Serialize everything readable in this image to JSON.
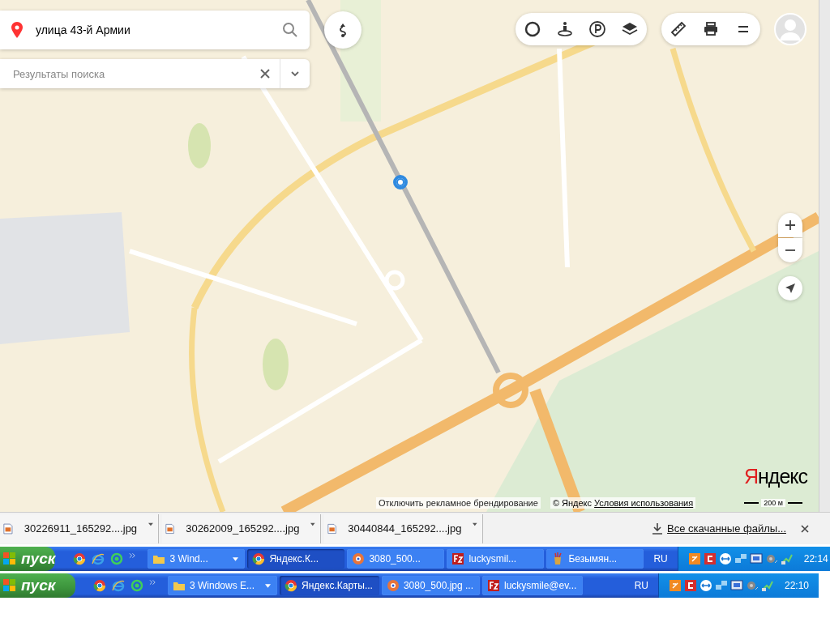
{
  "search": {
    "value": "улица 43-й Армии"
  },
  "results": {
    "placeholder": "Результаты поиска"
  },
  "map_footer": {
    "logo": "Яндекс",
    "disable_branding": "Отключить рекламное брендирование",
    "copyright": "© Яндекс",
    "terms_link": "Условия использования",
    "scale": "200 м"
  },
  "downloads": {
    "items": [
      "30226911_165292....jpg",
      "30262009_165292....jpg",
      "30440844_165292....jpg"
    ],
    "show_all": "Все скачанные файлы..."
  },
  "taskbars": [
    {
      "start": "пуск",
      "tasks": [
        {
          "kind": "folder",
          "label": "3 Wind...",
          "selected": false,
          "group": true
        },
        {
          "kind": "chrome",
          "label": "Яндекс.К...",
          "selected": true,
          "group": false
        },
        {
          "kind": "viewer",
          "label": "3080_500...",
          "selected": false,
          "group": false
        },
        {
          "kind": "ftp",
          "label": "luckysmil...",
          "selected": false,
          "group": false
        },
        {
          "kind": "paint",
          "label": "Безымян...",
          "selected": false,
          "group": false
        }
      ],
      "lang": "RU",
      "time": "22:14"
    },
    {
      "start": "пуск",
      "tasks": [
        {
          "kind": "folder",
          "label": "3 Windows E...",
          "selected": false,
          "group": true
        },
        {
          "kind": "chrome",
          "label": "Яндекс.Карты...",
          "selected": true,
          "group": false
        },
        {
          "kind": "viewer",
          "label": "3080_500.jpg ...",
          "selected": false,
          "group": false
        },
        {
          "kind": "ftp",
          "label": "luckysmile@ev...",
          "selected": false,
          "group": false
        }
      ],
      "lang": "RU",
      "time": "22:10"
    }
  ]
}
